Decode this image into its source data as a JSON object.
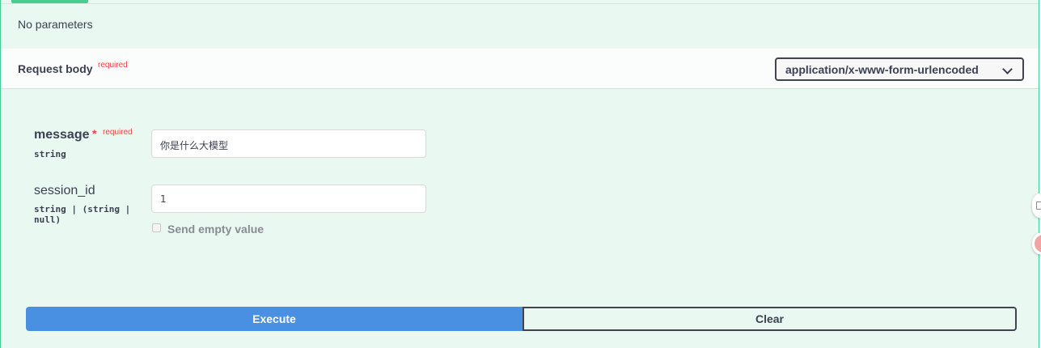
{
  "parameters": {
    "empty_text": "No parameters"
  },
  "request_body": {
    "title": "Request body",
    "required_label": "required",
    "content_type": "application/x-www-form-urlencoded"
  },
  "fields": [
    {
      "name": "message",
      "required_star": "*",
      "required_label": "required",
      "type": "string",
      "value": "你是什么大模型"
    },
    {
      "name": "session_id",
      "type_line1": "string | (string |",
      "type_line2": "null)",
      "value": "1",
      "send_empty_label": "Send empty value"
    }
  ],
  "actions": {
    "execute_label": "Execute",
    "clear_label": "Clear"
  },
  "colors": {
    "accent": "#49cc90",
    "execute": "#4990e2",
    "required": "#f93e3e"
  }
}
